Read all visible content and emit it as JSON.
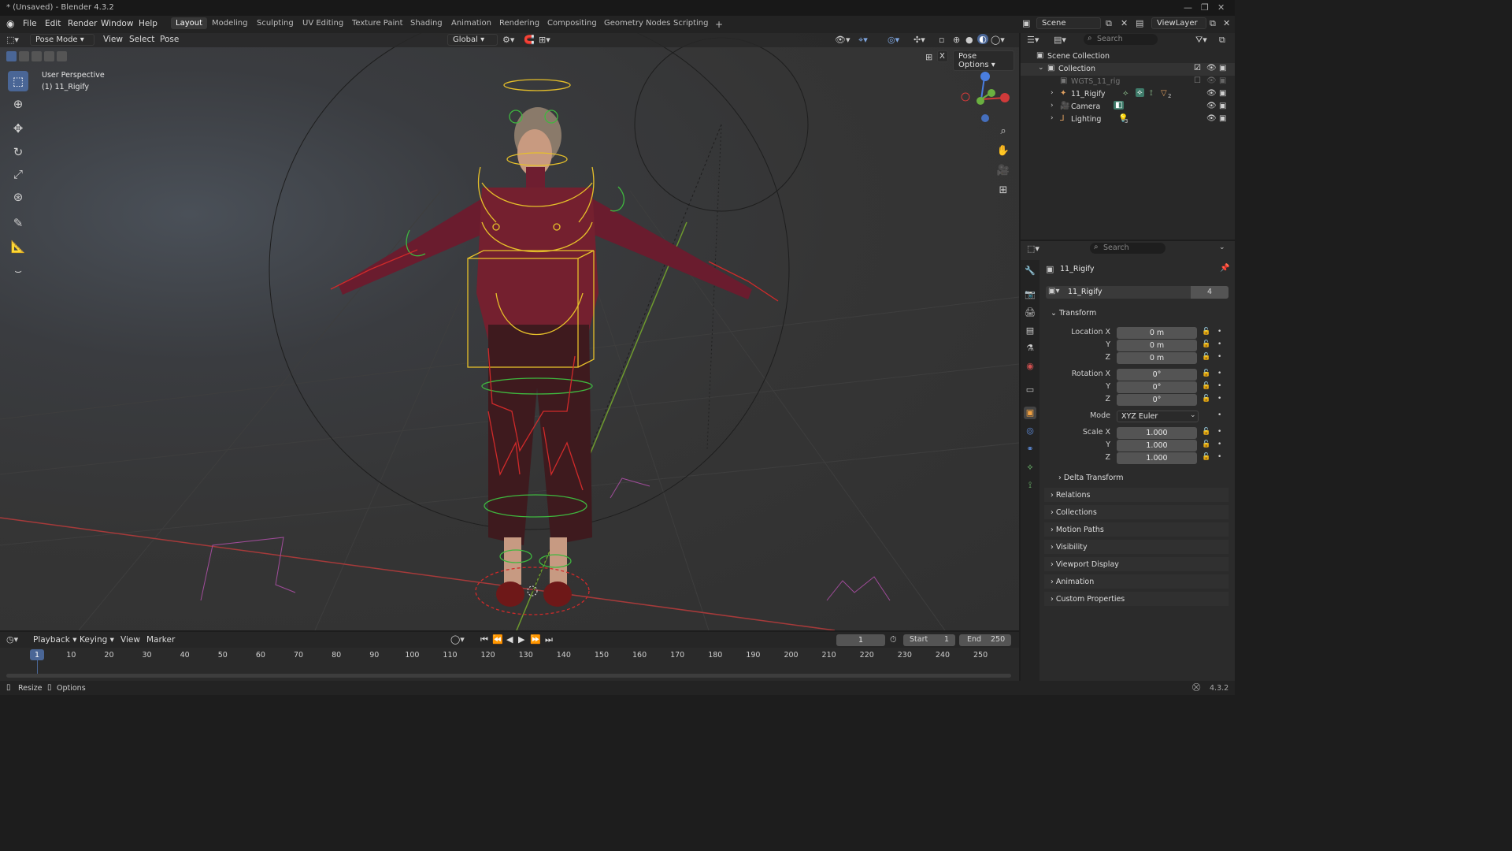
{
  "window": {
    "title": "* (Unsaved) - Blender 4.3.2"
  },
  "menu": [
    "File",
    "Edit",
    "Render",
    "Window",
    "Help"
  ],
  "workspaces": [
    "Layout",
    "Modeling",
    "Sculpting",
    "UV Editing",
    "Texture Paint",
    "Shading",
    "Animation",
    "Rendering",
    "Compositing",
    "Geometry Nodes",
    "Scripting"
  ],
  "active_workspace": "Layout",
  "scene": {
    "name": "Scene",
    "view_layer": "ViewLayer"
  },
  "viewport": {
    "mode": "Pose Mode",
    "menus": [
      "View",
      "Select",
      "Pose"
    ],
    "orientation": "Global",
    "pose_options": "Pose Options",
    "perspective": "User Perspective",
    "active_object": "(1) 11_Rigify",
    "x_mirror": "X"
  },
  "outliner": {
    "search_placeholder": "Search",
    "items": [
      {
        "label": "Scene Collection"
      },
      {
        "label": "Collection"
      },
      {
        "label": "WGTS_11_rig"
      },
      {
        "label": "11_Rigify",
        "badge": "2"
      },
      {
        "label": "Camera"
      },
      {
        "label": "Lighting",
        "badge": "3"
      }
    ]
  },
  "properties": {
    "search_placeholder": "Search",
    "object_name": "11_Rigify",
    "datablock_name": "11_Rigify",
    "users": "4",
    "transform": {
      "header": "Transform",
      "location": {
        "label": "Location X",
        "x": "0 m",
        "y": "0 m",
        "z": "0 m"
      },
      "rotation": {
        "label": "Rotation X",
        "x": "0°",
        "y": "0°",
        "z": "0°"
      },
      "mode": {
        "label": "Mode",
        "value": "XYZ Euler"
      },
      "scale": {
        "label": "Scale X",
        "x": "1.000",
        "y": "1.000",
        "z": "1.000"
      },
      "axis_y": "Y",
      "axis_z": "Z",
      "delta": "Delta Transform"
    },
    "panels": [
      "Relations",
      "Collections",
      "Motion Paths",
      "Visibility",
      "Viewport Display",
      "Animation",
      "Custom Properties"
    ]
  },
  "timeline": {
    "menus": [
      "Playback",
      "Keying",
      "View",
      "Marker"
    ],
    "current_frame": "1",
    "start_label": "Start",
    "start": "1",
    "end_label": "End",
    "end": "250",
    "ruler": [
      "1",
      "10",
      "20",
      "30",
      "40",
      "50",
      "60",
      "70",
      "80",
      "90",
      "100",
      "110",
      "120",
      "130",
      "140",
      "150",
      "160",
      "170",
      "180",
      "190",
      "200",
      "210",
      "220",
      "230",
      "240",
      "250"
    ]
  },
  "statusbar": {
    "resize": "Resize",
    "options": "Options",
    "version": "4.3.2"
  },
  "colors": {
    "accent": "#4a6696",
    "bone_yellow": "#e6c02a",
    "bone_green": "#3fb83f",
    "bone_red": "#d02a2a",
    "grid_red": "#b03a3a",
    "grid_green": "#6a9a2a"
  }
}
